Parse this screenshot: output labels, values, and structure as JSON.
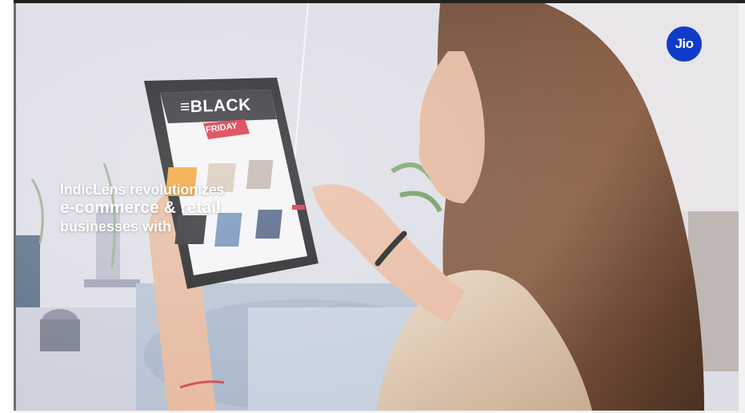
{
  "video": {
    "overlay": {
      "line1": "IndicLens revolutionizes",
      "line2": "e-commerce & retail",
      "line3": "businesses with"
    },
    "brand_logo": "Jio",
    "tablet_screen": {
      "headline": "≡BLACK",
      "subheadline": "FRIDAY"
    }
  },
  "colors": {
    "logo_bg": "#0f3cc9",
    "tag_red": "#d8283a",
    "tablet_body": "#1f1f22"
  }
}
